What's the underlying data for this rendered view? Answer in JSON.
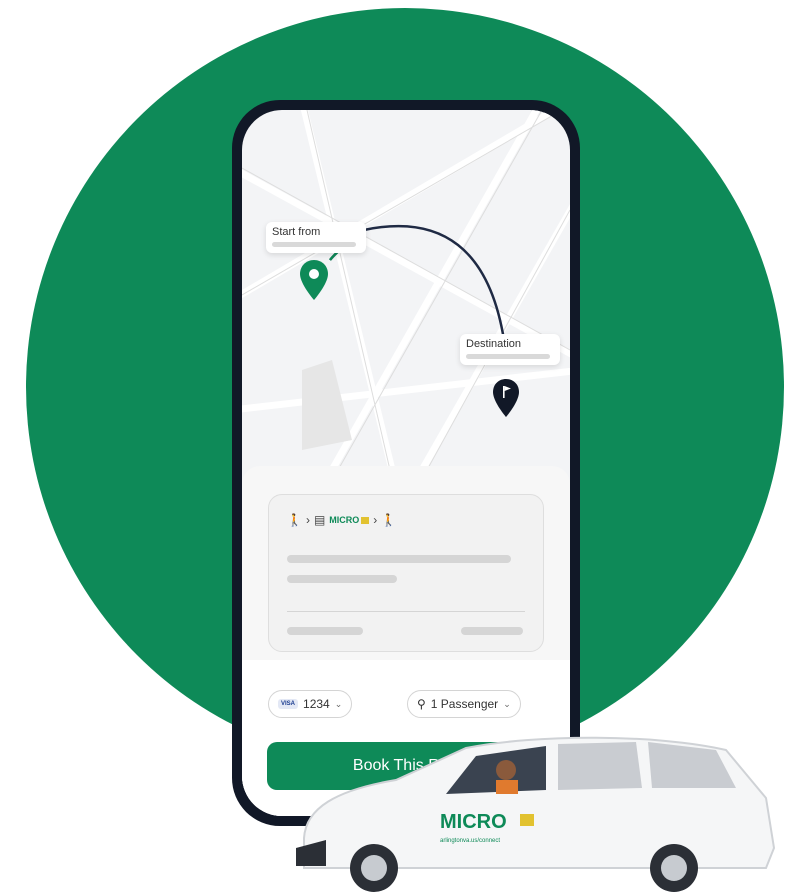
{
  "map": {
    "start_label": "Start from",
    "destination_label": "Destination"
  },
  "trip_card": {
    "brand": "MICRO"
  },
  "payment": {
    "card_last_four": "1234",
    "card_brand": "VISA"
  },
  "passengers": {
    "label": "1 Passenger"
  },
  "book_button": {
    "label": "Book This Ride"
  },
  "vehicle": {
    "brand": "MICRO",
    "tagline": "arlingtonva.us/connect"
  },
  "colors": {
    "brand_green": "#0e8a58",
    "accent_yellow": "#e2c230",
    "dark": "#111827"
  }
}
